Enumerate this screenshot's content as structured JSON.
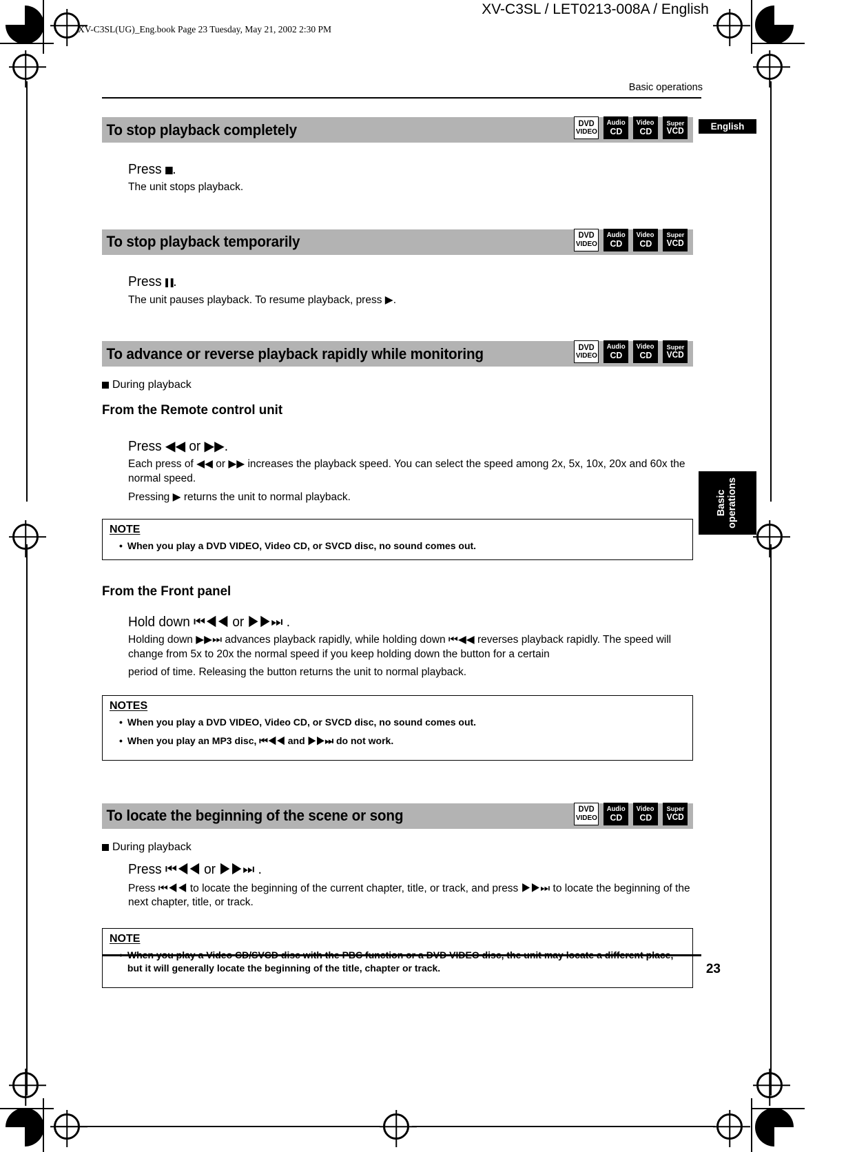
{
  "header": {
    "doc_title": "XV-C3SL / LET0213-008A / English",
    "file_stamp": "XV-C3SL(UG)_Eng.book  Page 23  Tuesday, May 21, 2002  2:30 PM",
    "running_head": "Basic operations"
  },
  "tabs": {
    "language": "English",
    "side_tab_line1": "Basic",
    "side_tab_line2": "operations"
  },
  "disc_icons": [
    {
      "name": "dvd-video-icon",
      "line1": "DVD",
      "line2": "VIDEO",
      "style": "light"
    },
    {
      "name": "audio-cd-icon",
      "line1": "Audio",
      "line2": "CD",
      "style": "dark"
    },
    {
      "name": "video-cd-icon",
      "line1": "Video",
      "line2": "CD",
      "style": "dark"
    },
    {
      "name": "super-vcd-icon",
      "line1": "Super",
      "line2": "VCD",
      "style": "dark"
    }
  ],
  "sections": {
    "stop_completely": {
      "title": "To stop playback completely",
      "press": "Press ■.",
      "press_prefix": "Press ",
      "press_suffix": ".",
      "body1": "The unit stops playback."
    },
    "stop_temporarily": {
      "title": "To stop playback temporarily",
      "press_prefix": "Press ",
      "press_suffix": ".",
      "body1_a": "The unit pauses playback.  To resume playback, press ",
      "body1_b": "▶",
      "body1_c": "."
    },
    "advance_reverse": {
      "title": "To advance or reverse playback rapidly while monitoring",
      "during_playback": "During playback",
      "remote_head": "From the Remote control unit",
      "remote_press": "Press ◀◀ or ▶▶.",
      "remote_body1": "Each press of ◀◀ or ▶▶ increases the playback speed. You can select the speed among 2x, 5x, 10x, 20x and 60x the normal speed.",
      "remote_body2": "Pressing ▶ returns the unit to normal playback.",
      "note_title": "NOTE",
      "note_items": [
        "When you play a DVD VIDEO, Video CD, or SVCD disc, no sound comes out."
      ],
      "front_head": "From the Front panel",
      "front_press": "Hold down ⏮◀◀ or ▶▶⏭ .",
      "front_body1": "Holding down ▶▶⏭ advances playback rapidly, while holding down ⏮◀◀ reverses playback rapidly. The speed will change from 5x to 20x the normal speed if you keep holding down the button for a certain",
      "front_body2": "period of time. Releasing the button returns the unit to normal playback.",
      "notes_title": "NOTES",
      "notes_items": [
        "When you play a DVD VIDEO, Video CD, or SVCD disc, no sound comes out.",
        "When you play an MP3 disc, ⏮◀◀ and ▶▶⏭ do not work."
      ]
    },
    "locate_beginning": {
      "title": "To locate the beginning of the scene or song",
      "during_playback": "During playback",
      "press": "Press ⏮◀◀ or ▶▶⏭ .",
      "body1": "Press ⏮◀◀ to locate the beginning of the current chapter, title, or track, and press ▶▶⏭ to locate the beginning of the next chapter, title, or track.",
      "note_title": "NOTE",
      "note_items": [
        "When you play a Video CD/SVCD disc with the PBC function or a DVD VIDEO disc, the unit may locate a different place, but it will generally locate the beginning of the title, chapter or track."
      ]
    }
  },
  "footer": {
    "page_number": "23"
  },
  "colors": {
    "section_bar": "#b3b3b3",
    "tab_background": "#000000",
    "text": "#000000"
  }
}
